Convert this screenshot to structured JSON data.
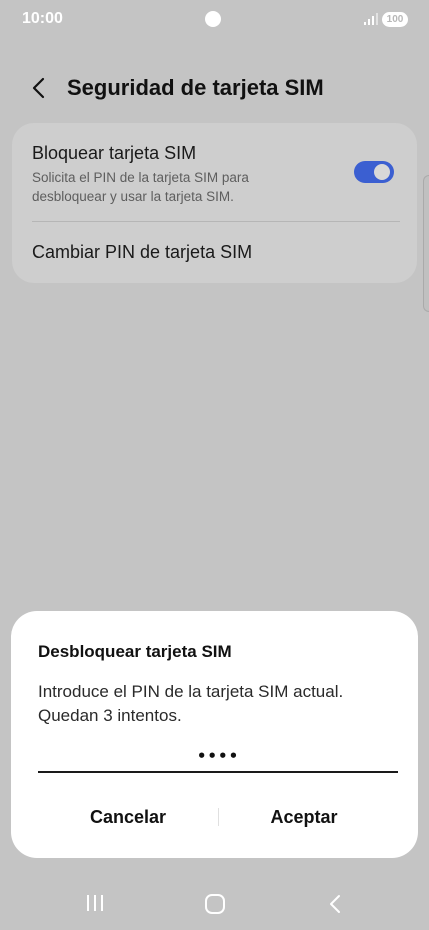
{
  "status_bar": {
    "time": "10:00",
    "battery": "100",
    "icons": [
      "camera-dot",
      "signal-icon",
      "battery-icon"
    ]
  },
  "header": {
    "title": "Seguridad de tarjeta SIM",
    "back_icon": "chevron-left-icon"
  },
  "settings": {
    "lock_sim": {
      "title": "Bloquear tarjeta SIM",
      "description": "Solicita el PIN de la tarjeta SIM para desbloquear y usar la tarjeta SIM.",
      "enabled": true
    },
    "change_pin": {
      "label": "Cambiar PIN de tarjeta SIM"
    }
  },
  "dialog": {
    "title": "Desbloquear tarjeta SIM",
    "message": "Introduce el PIN de la tarjeta SIM actual. Quedan 3 intentos.",
    "pin_value": "••••",
    "cancel_label": "Cancelar",
    "accept_label": "Aceptar"
  },
  "nav_bar": {
    "icons": [
      "recents-icon",
      "home-icon",
      "back-icon"
    ]
  },
  "colors": {
    "background_dimmed": "#c4c4c4",
    "toggle_accent": "#3b5fd1",
    "dialog_background": "#ffffff"
  }
}
